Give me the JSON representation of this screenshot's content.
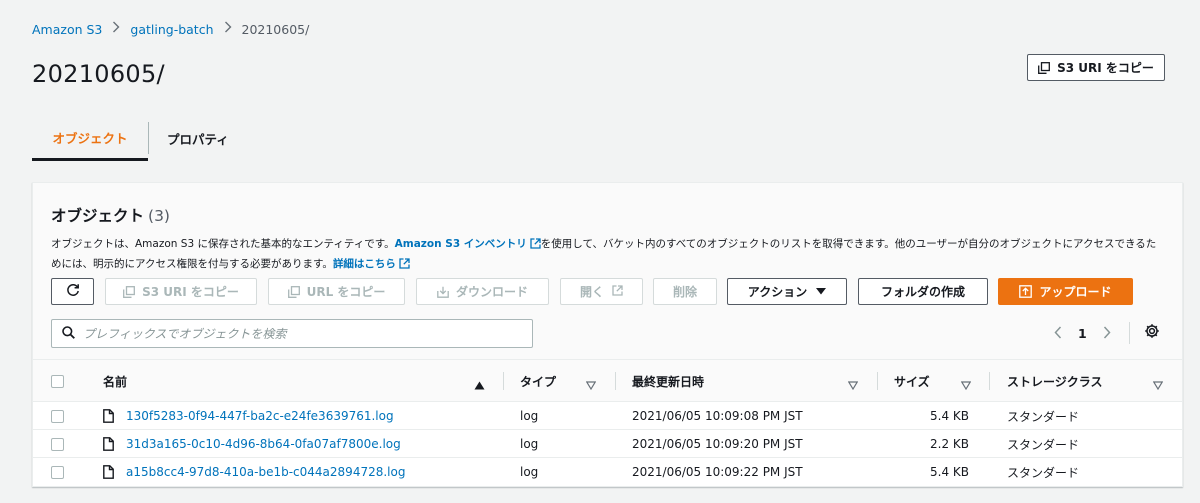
{
  "breadcrumb": {
    "items": [
      "Amazon S3",
      "gatling-batch"
    ],
    "current": "20210605/"
  },
  "page_title": "20210605/",
  "copy_uri_top_label": "S3 URI をコピー",
  "tabs": [
    "オブジェクト",
    "プロパティ"
  ],
  "panel": {
    "title": "オブジェクト",
    "count": "(3)",
    "desc_part1": "オブジェクトは、Amazon S3 に保存された基本的なエンティティです。",
    "desc_link1": "Amazon S3 インベントリ",
    "desc_part2": "を使用して、バケット内のすべてのオブジェクトのリストを取得できます。他のユーザーが自分のオブジェクトにアクセスできるためには、明示的にアクセス権限を付与する必要があります。",
    "desc_link2": "詳細はこちら"
  },
  "toolbar": {
    "copy_s3_uri": "S3 URI をコピー",
    "copy_url": "URL をコピー",
    "download": "ダウンロード",
    "open": "開く",
    "delete": "削除",
    "actions": "アクション",
    "create_folder": "フォルダの作成",
    "upload": "アップロード"
  },
  "search": {
    "placeholder": "プレフィックスでオブジェクトを検索"
  },
  "pagination": {
    "current_page": "1"
  },
  "table": {
    "columns": [
      "名前",
      "タイプ",
      "最終更新日時",
      "サイズ",
      "ストレージクラス"
    ],
    "rows": [
      {
        "name": "130f5283-0f94-447f-ba2c-e24fe3639761.log",
        "type": "log",
        "modified": "2021/06/05 10:09:08 PM JST",
        "size": "5.4 KB",
        "storage": "スタンダード"
      },
      {
        "name": "31d3a165-0c10-4d96-8b64-0fa07af7800e.log",
        "type": "log",
        "modified": "2021/06/05 10:09:20 PM JST",
        "size": "2.2 KB",
        "storage": "スタンダード"
      },
      {
        "name": "a15b8cc4-97d8-410a-be1b-c044a2894728.log",
        "type": "log",
        "modified": "2021/06/05 10:09:22 PM JST",
        "size": "5.4 KB",
        "storage": "スタンダード"
      }
    ]
  },
  "colors": {
    "accent": "#ec7211",
    "link": "#0073bb",
    "text": "#16191f"
  }
}
